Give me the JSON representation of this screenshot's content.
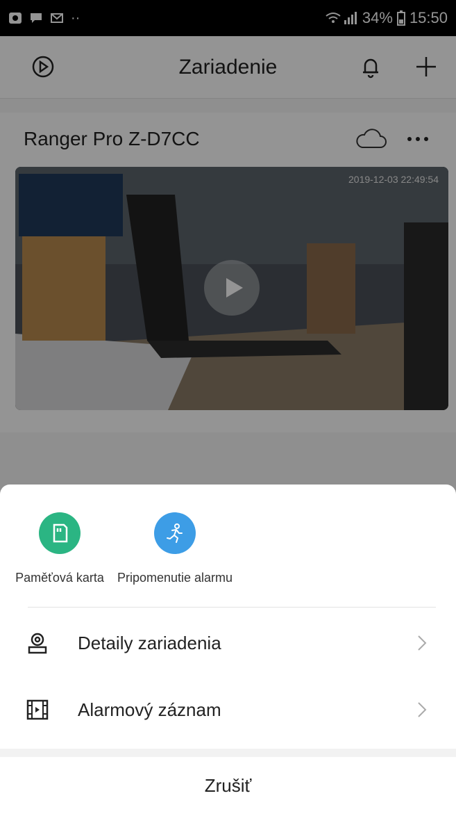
{
  "status_bar": {
    "signal_battery": "34%",
    "time": "15:50"
  },
  "header": {
    "title": "Zariadenie"
  },
  "device": {
    "name": "Ranger Pro Z-D7CC",
    "timestamp": "2019-12-03 22:49:54"
  },
  "sheet": {
    "quick_actions": [
      {
        "label": "Paměťová karta",
        "color": "#2bb583"
      },
      {
        "label": "Pripomenutie alarmu",
        "color": "#3d9de6"
      }
    ],
    "rows": [
      {
        "label": "Detaily zariadenia"
      },
      {
        "label": "Alarmový záznam"
      }
    ],
    "cancel_label": "Zrušiť"
  }
}
